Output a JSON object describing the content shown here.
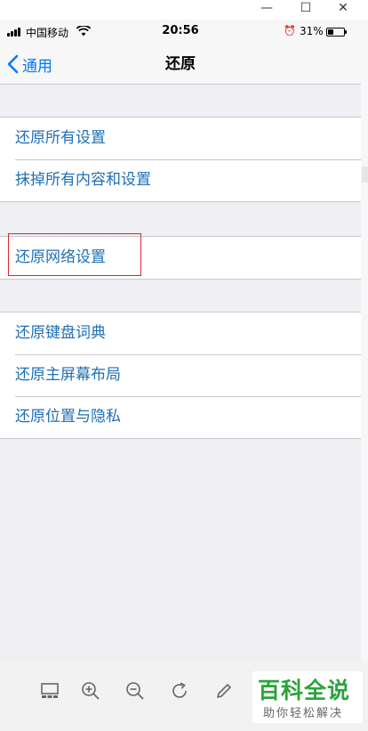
{
  "window": {
    "minimize_glyph": "—",
    "maximize_glyph": "☐",
    "close_glyph": "✕"
  },
  "status_bar": {
    "carrier": "中国移动",
    "time": "20:56",
    "battery_percent": "31%",
    "battery_level": 0.31
  },
  "nav": {
    "back_label": "通用",
    "title": "还原"
  },
  "groups": [
    {
      "items": [
        "还原所有设置",
        "抹掉所有内容和设置"
      ]
    },
    {
      "items": [
        "还原网络设置"
      ]
    },
    {
      "items": [
        "还原键盘词典",
        "还原主屏幕布局",
        "还原位置与隐私"
      ]
    }
  ],
  "toolbar": {
    "icons": [
      "thumbnail-icon",
      "zoom-in-icon",
      "zoom-out-icon",
      "rotate-icon",
      "edit-icon"
    ]
  },
  "watermark": {
    "title": "百科全说",
    "subtitle": "助你轻松解决"
  },
  "colors": {
    "ios_blue": "#007aff",
    "cell_text": "#1f6fb5",
    "highlight": "#e0242b",
    "watermark_green": "#2aa33b"
  }
}
